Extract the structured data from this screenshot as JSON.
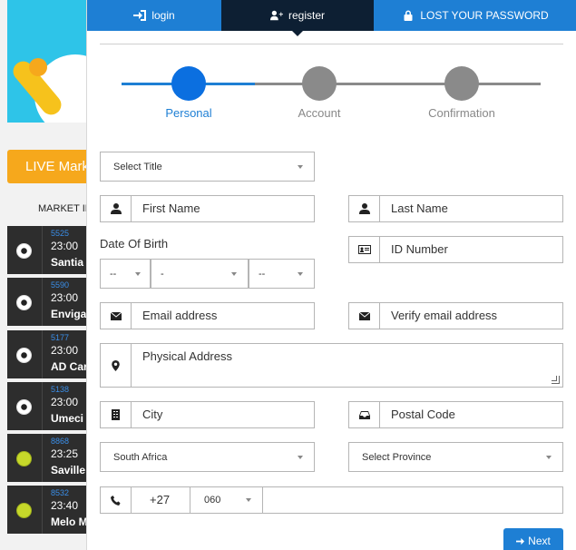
{
  "background": {
    "live_label": "LIVE Mark",
    "market_header": "MARKET IN",
    "matches": [
      {
        "id": "5525",
        "time": "23:00",
        "team": "Santia",
        "sport": "soccer-icon"
      },
      {
        "id": "5590",
        "time": "23:00",
        "team": "Enviga",
        "sport": "soccer-icon"
      },
      {
        "id": "5177",
        "time": "23:00",
        "team": "AD Car",
        "sport": "soccer-icon"
      },
      {
        "id": "5138",
        "time": "23:00",
        "team": "Umeci",
        "sport": "soccer-icon"
      },
      {
        "id": "8868",
        "time": "23:25",
        "team": "Saville",
        "sport": "tennis-icon"
      },
      {
        "id": "8532",
        "time": "23:40",
        "team": "Melo M",
        "sport": "tennis-icon"
      }
    ]
  },
  "tabs": {
    "login": "login",
    "register": "register",
    "lost_password": "LOST YOUR PASSWORD"
  },
  "steps": [
    {
      "label": "Personal",
      "active": true
    },
    {
      "label": "Account",
      "active": false
    },
    {
      "label": "Confirmation",
      "active": false
    }
  ],
  "form": {
    "title_select": "Select Title",
    "first_name": "First Name",
    "last_name": "Last Name",
    "dob_label": "Date Of Birth",
    "dob_day": "--",
    "dob_month": "-",
    "dob_year": "--",
    "id_number": "ID Number",
    "email": "Email address",
    "verify_email": "Verify email address",
    "physical_address": "Physical Address",
    "city": "City",
    "postal_code": "Postal Code",
    "country": "South Africa",
    "province": "Select Province",
    "phone_code": "+27",
    "phone_prefix": "060",
    "phone_number": ""
  },
  "next_button": "Next",
  "colors": {
    "primary": "#1e7fd4",
    "dark_tab": "#0d1f33",
    "active_step": "#0b6fe0",
    "inactive_step": "#8a8a8a",
    "live_bar": "#f6a81c"
  }
}
